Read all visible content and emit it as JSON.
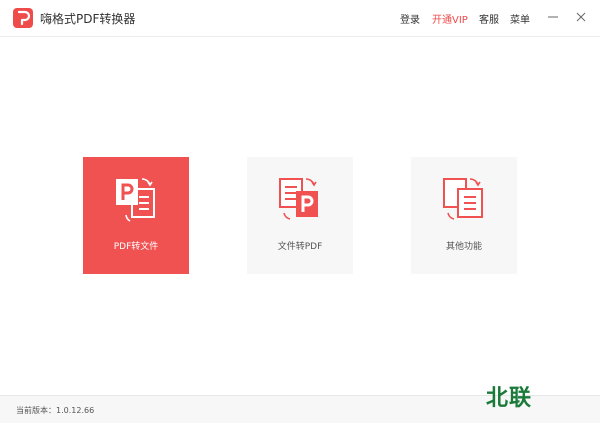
{
  "app": {
    "title": "嗨格式PDF转换器"
  },
  "header": {
    "login": "登录",
    "vip": "开通VIP",
    "service": "客服",
    "menu": "菜单"
  },
  "cards": [
    {
      "label": "PDF转文件",
      "icon": "pdf-to-file-icon",
      "selected": true
    },
    {
      "label": "文件转PDF",
      "icon": "file-to-pdf-icon",
      "selected": false
    },
    {
      "label": "其他功能",
      "icon": "other-functions-icon",
      "selected": false
    }
  ],
  "footer": {
    "version": "当前版本：1.0.12.66"
  },
  "watermark": "北联",
  "colors": {
    "accent": "#ef4b4b",
    "watermark": "#1a7a3a"
  }
}
